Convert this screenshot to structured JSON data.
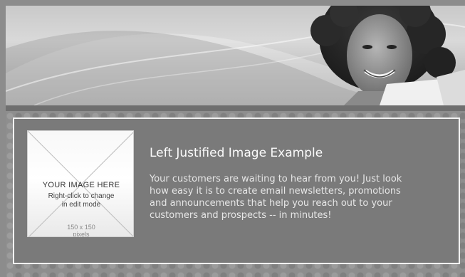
{
  "placeholder": {
    "title": "YOUR IMAGE HERE",
    "hint_line1": "Right-click to change",
    "hint_line2": "in edit mode",
    "size_line1": "150 x 150",
    "size_line2": "pixels"
  },
  "content": {
    "heading": "Left Justified Image Example",
    "body_lines": [
      "Your customers are waiting to hear from you! Just look",
      "how easy it is to create email newsletters, promotions",
      "and announcements that help you reach out to your",
      "customers and prospects -- in minutes!"
    ]
  },
  "colors": {
    "panel": "#7a7a7a",
    "panel_border": "#f2f2f2",
    "heading": "#fbfbfb",
    "body_text": "#e6e6e6"
  }
}
